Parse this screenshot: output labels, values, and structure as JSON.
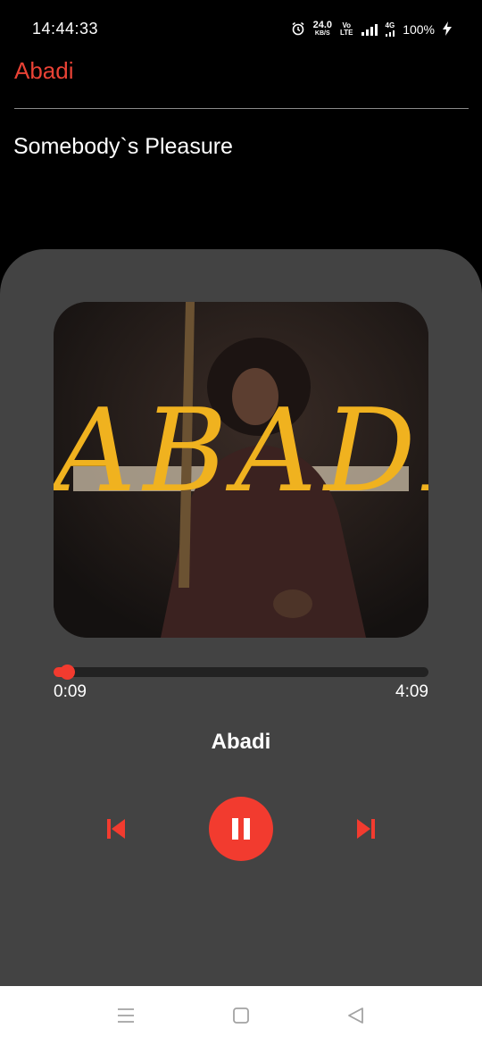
{
  "status_bar": {
    "time": "14:44:33",
    "speed_value": "24.0",
    "speed_unit": "KB/S",
    "volte_top": "Vo",
    "volte_bottom": "LTE",
    "network_label": "4G",
    "battery": "100%",
    "icons": [
      "alarm-icon",
      "signal-icon",
      "charging-icon"
    ]
  },
  "header": {
    "title": "Abadi"
  },
  "song_heading": "Somebody`s Pleasure",
  "player": {
    "album_art_text": "ABADI",
    "current_time": "0:09",
    "total_time": "4:09",
    "progress_fraction": 0.036,
    "track_title": "Abadi",
    "controls": {
      "previous_icon": "skip-previous-icon",
      "play_pause_icon": "pause-icon",
      "next_icon": "skip-next-icon"
    }
  },
  "nav_bar": {
    "icons": [
      "menu-icon",
      "home-icon",
      "back-icon"
    ]
  },
  "colors": {
    "accent": "#f23b2f",
    "header_title": "#e94235",
    "panel": "#434343",
    "album_text": "#f0b21f",
    "background": "#000000"
  }
}
